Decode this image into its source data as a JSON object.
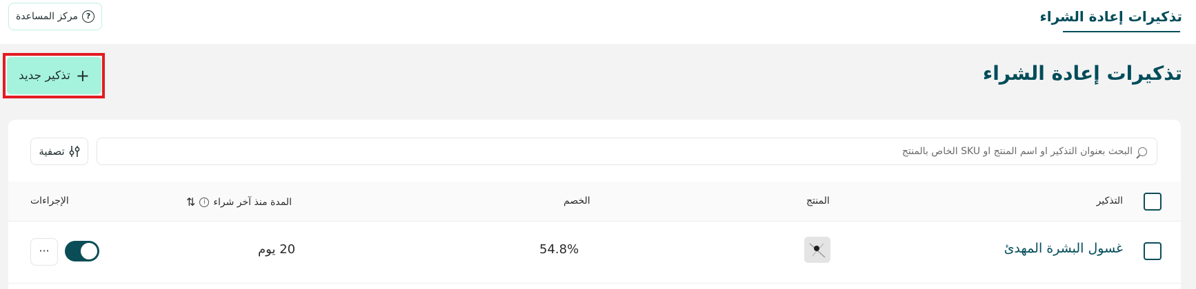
{
  "topbar": {
    "active_tab": "تذكيرات إعادة الشراء",
    "help_label": "مركز المساعدة",
    "help_icon": "?"
  },
  "page": {
    "title": "تذكيرات إعادة الشراء",
    "new_button_label": "تذكير جديد",
    "new_button_icon": "+",
    "highlight_color": "#e31b23",
    "accent_color": "#a5f3dc",
    "brand_color": "#004c59"
  },
  "search": {
    "placeholder": "البحث بعنوان التذكير او اسم المنتج او SKU الخاص بالمنتج",
    "icon": "search-icon"
  },
  "filter": {
    "label": "تصفية",
    "icon": "sliders-icon"
  },
  "table": {
    "columns": {
      "reminder": "التذكير",
      "product": "المنتج",
      "discount": "الخصم",
      "duration": "المدة منذ آخر شراء",
      "actions": "الإجراءات"
    },
    "rows": [
      {
        "reminder": "غسول البشرة المهدئ",
        "discount": "54.8%",
        "duration": "20 يوم",
        "enabled": true,
        "more": "···"
      }
    ]
  }
}
